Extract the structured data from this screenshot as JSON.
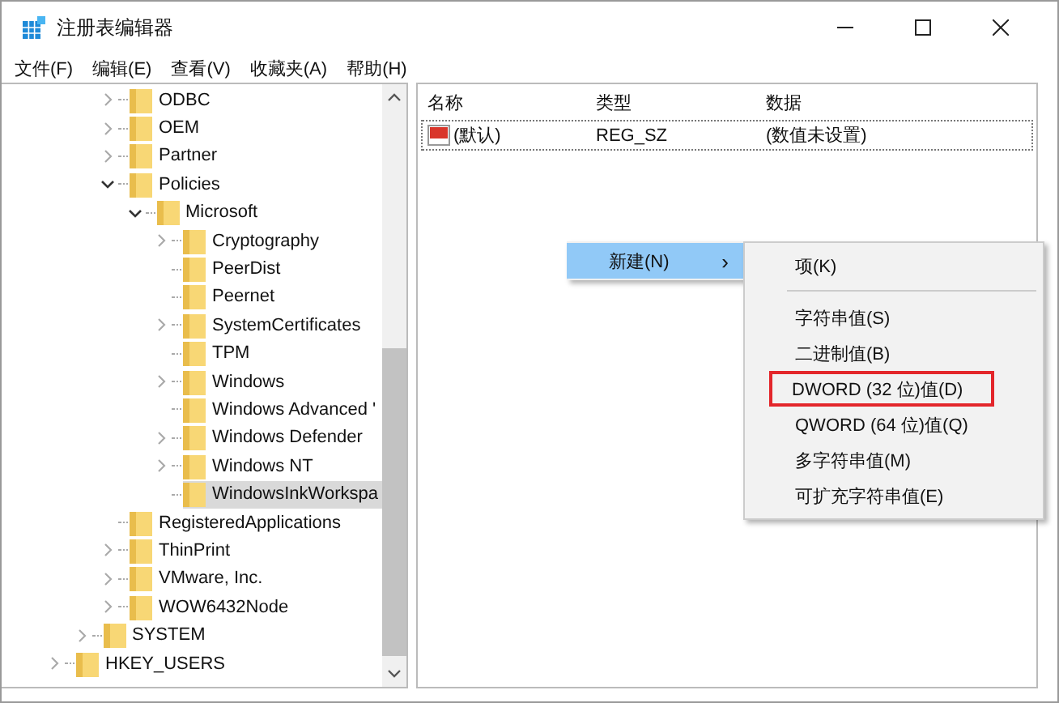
{
  "window": {
    "title": "注册表编辑器"
  },
  "menu_bar": [
    "文件(F)",
    "编辑(E)",
    "查看(V)",
    "收藏夹(A)",
    "帮助(H)"
  ],
  "tree": {
    "items": [
      {
        "children": [
          {
            "children": [
              {
                "label": "ODBC",
                "expanded": false,
                "selected": false
              },
              {
                "label": "OEM",
                "expanded": false,
                "selected": false
              },
              {
                "label": "Partner",
                "expanded": false,
                "selected": false
              },
              {
                "label": "Policies",
                "expanded": true,
                "selected": false,
                "children": [
                  {
                    "label": "Microsoft",
                    "expanded": true,
                    "selected": false,
                    "children": [
                      {
                        "label": "Cryptography",
                        "expanded": false,
                        "selected": false
                      },
                      {
                        "label": "PeerDist",
                        "selected": false
                      },
                      {
                        "label": "Peernet",
                        "selected": false
                      },
                      {
                        "label": "SystemCertificates",
                        "expanded": false,
                        "selected": false
                      },
                      {
                        "label": "TPM",
                        "selected": false
                      },
                      {
                        "label": "Windows",
                        "expanded": false,
                        "selected": false
                      },
                      {
                        "label": "Windows Advanced '",
                        "selected": false
                      },
                      {
                        "label": "Windows Defender",
                        "expanded": false,
                        "selected": false
                      },
                      {
                        "label": "Windows NT",
                        "expanded": false,
                        "selected": false
                      },
                      {
                        "label": "WindowsInkWorkspa",
                        "selected": true
                      }
                    ]
                  }
                ]
              },
              {
                "label": "RegisteredApplications",
                "selected": false
              },
              {
                "label": "ThinPrint",
                "expanded": false,
                "selected": false
              },
              {
                "label": "VMware, Inc.",
                "expanded": false,
                "selected": false
              },
              {
                "label": "WOW6432Node",
                "expanded": false,
                "selected": false
              }
            ]
          },
          {
            "label": "SYSTEM",
            "expanded": false,
            "selected": false
          }
        ]
      },
      {
        "label": "HKEY_USERS",
        "expanded": false,
        "selected": false
      }
    ]
  },
  "values_table": {
    "columns": [
      "名称",
      "类型",
      "数据"
    ],
    "rows": [
      {
        "name": "(默认)",
        "type": "REG_SZ",
        "data": "(数值未设置)",
        "focused": true
      }
    ]
  },
  "context_menu": {
    "items": [
      {
        "label": "新建(N)",
        "arrow": "›",
        "selected": true
      }
    ]
  },
  "submenu": {
    "items": [
      {
        "kind": "item",
        "label": "项(K)",
        "highlighted": false
      },
      {
        "kind": "separator"
      },
      {
        "kind": "item",
        "label": "字符串值(S)",
        "highlighted": false
      },
      {
        "kind": "item",
        "label": "二进制值(B)",
        "highlighted": false
      },
      {
        "kind": "item",
        "label": "DWORD (32 位)值(D)",
        "highlighted": true
      },
      {
        "kind": "item",
        "label": "QWORD (64 位)值(Q)",
        "highlighted": false
      },
      {
        "kind": "item",
        "label": "多字符串值(M)",
        "highlighted": false
      },
      {
        "kind": "item",
        "label": "可扩充字符串值(E)",
        "highlighted": false
      }
    ]
  }
}
